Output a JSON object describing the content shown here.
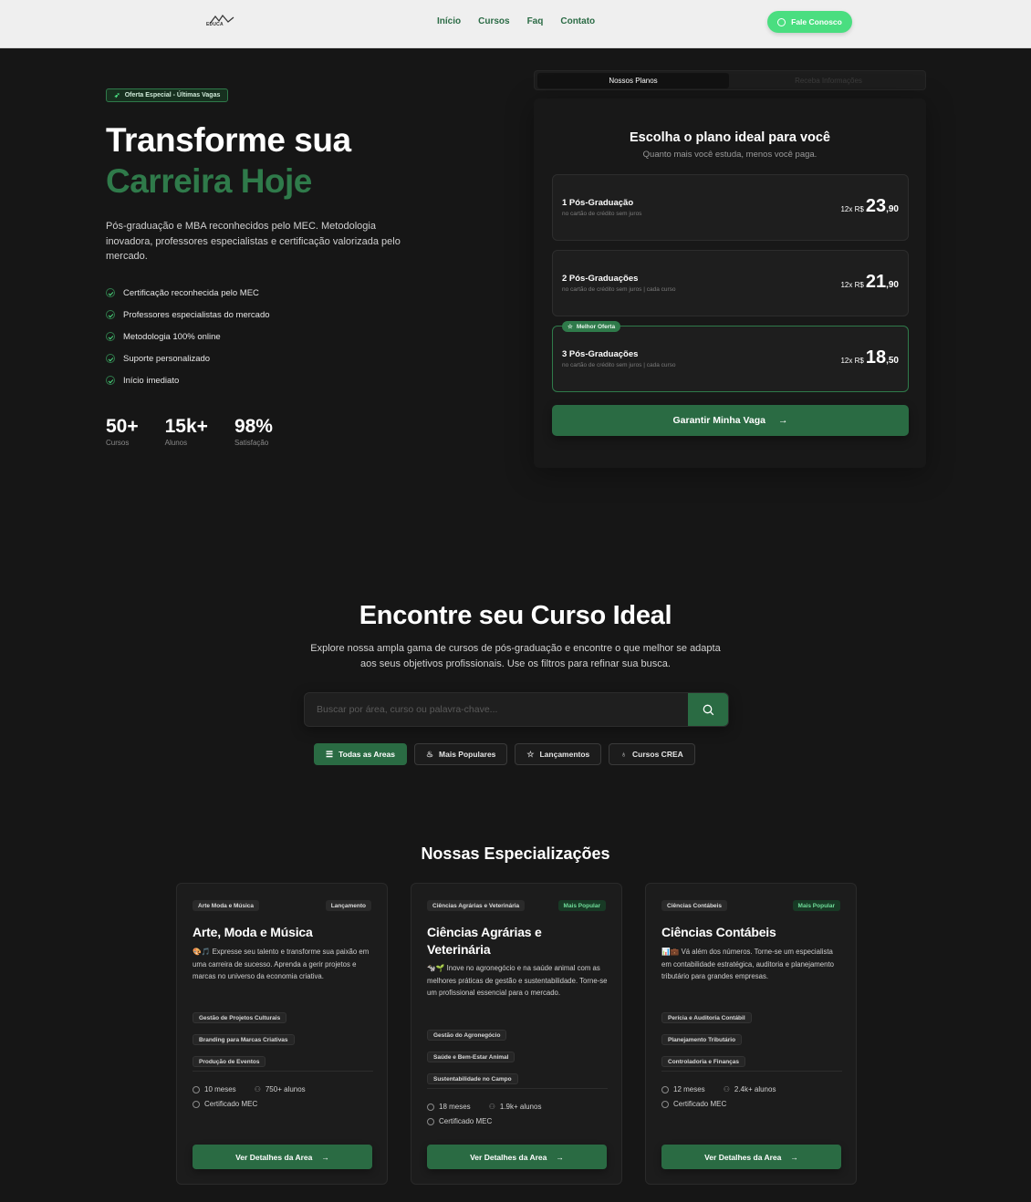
{
  "nav": {
    "logo_text": "EDUCA",
    "links": [
      "Início",
      "Cursos",
      "Faq",
      "Contato"
    ],
    "cta": "Fale Conosco"
  },
  "hero": {
    "badge": "Oferta Especial - Últimas Vagas",
    "title_line1": "Transforme sua",
    "title_line2": "Carreira Hoje",
    "description": "Pós-graduação e MBA reconhecidos pelo MEC. Metodologia inovadora, professores especialistas e certificação valorizada pelo mercado.",
    "bullets": [
      "Certificação reconhecida pelo MEC",
      "Professores especialistas do mercado",
      "Metodologia 100% online",
      "Suporte personalizado",
      "Início imediato"
    ],
    "stats": [
      {
        "value": "50+",
        "label": "Cursos"
      },
      {
        "value": "15k+",
        "label": "Alunos"
      },
      {
        "value": "98%",
        "label": "Satisfação"
      }
    ]
  },
  "plans": {
    "tab_active": "Nossos Planos",
    "tab_inactive": "Receba Informações",
    "title": "Escolha o plano ideal para você",
    "subtitle": "Quanto mais você estuda, menos você paga.",
    "options": [
      {
        "name": "1 Pós-Graduação",
        "sub": "no cartão de crédito sem juros",
        "prefix": "12x R$",
        "price": "23",
        "cents": ",90"
      },
      {
        "name": "2 Pós-Graduações",
        "sub": "no cartão de crédito sem juros | cada curso",
        "prefix": "12x R$",
        "price": "21",
        "cents": ",90"
      },
      {
        "name": "3 Pós-Graduações",
        "sub": "no cartão de crédito sem juros | cada curso",
        "prefix": "12x R$",
        "price": "18",
        "cents": ",50",
        "badge": "Melhor Oferta"
      }
    ],
    "cta": "Garantir Minha Vaga"
  },
  "search": {
    "title": "Encontre seu Curso Ideal",
    "description": "Explore nossa ampla gama de cursos de pós-graduação e encontre o que melhor se adapta aos seus objetivos profissionais. Use os filtros para refinar sua busca.",
    "placeholder": "Buscar por área, curso ou palavra-chave...",
    "filters": [
      "Todas as Areas",
      "Mais Populares",
      "Lançamentos",
      "Cursos CREA"
    ]
  },
  "specializations": {
    "title": "Nossas Especializações",
    "cards": [
      {
        "category": "Arte Moda e Música",
        "tag": "Lançamento",
        "title": "Arte, Moda e Música",
        "description": "🎨🎵 Expresse seu talento e transforme sua paixão em uma carreira de sucesso. Aprenda a gerir projetos e marcas no universo da economia criativa.",
        "chips": [
          "Gestão de Projetos Culturais",
          "Branding para Marcas Criativas",
          "Produção de Eventos"
        ],
        "duration": "10 meses",
        "students": "750+ alunos",
        "cert": "Certificado MEC",
        "button": "Ver Detalhes da Area"
      },
      {
        "category": "Ciências Agrárias e Veterinária",
        "tag": "Mais Popular",
        "title": "Ciências Agrárias e Veterinária",
        "description": "🐄🌱 Inove no agronegócio e na saúde animal com as melhores práticas de gestão e sustentabilidade. Torne-se um profissional essencial para o mercado.",
        "chips": [
          "Gestão do Agronegócio",
          "Saúde e Bem-Estar Animal",
          "Sustentabilidade no Campo"
        ],
        "duration": "18 meses",
        "students": "1.9k+ alunos",
        "cert": "Certificado MEC",
        "button": "Ver Detalhes da Area"
      },
      {
        "category": "Ciências Contábeis",
        "tag": "Mais Popular",
        "title": "Ciências Contábeis",
        "description": "📊💼 Vá além dos números. Torne-se um especialista em contabilidade estratégica, auditoria e planejamento tributário para grandes empresas.",
        "chips": [
          "Perícia e Auditoria Contábil",
          "Planejamento Tributário",
          "Controladoria e Finanças"
        ],
        "duration": "12 meses",
        "students": "2.4k+ alunos",
        "cert": "Certificado MEC",
        "button": "Ver Detalhes da Area"
      }
    ]
  }
}
